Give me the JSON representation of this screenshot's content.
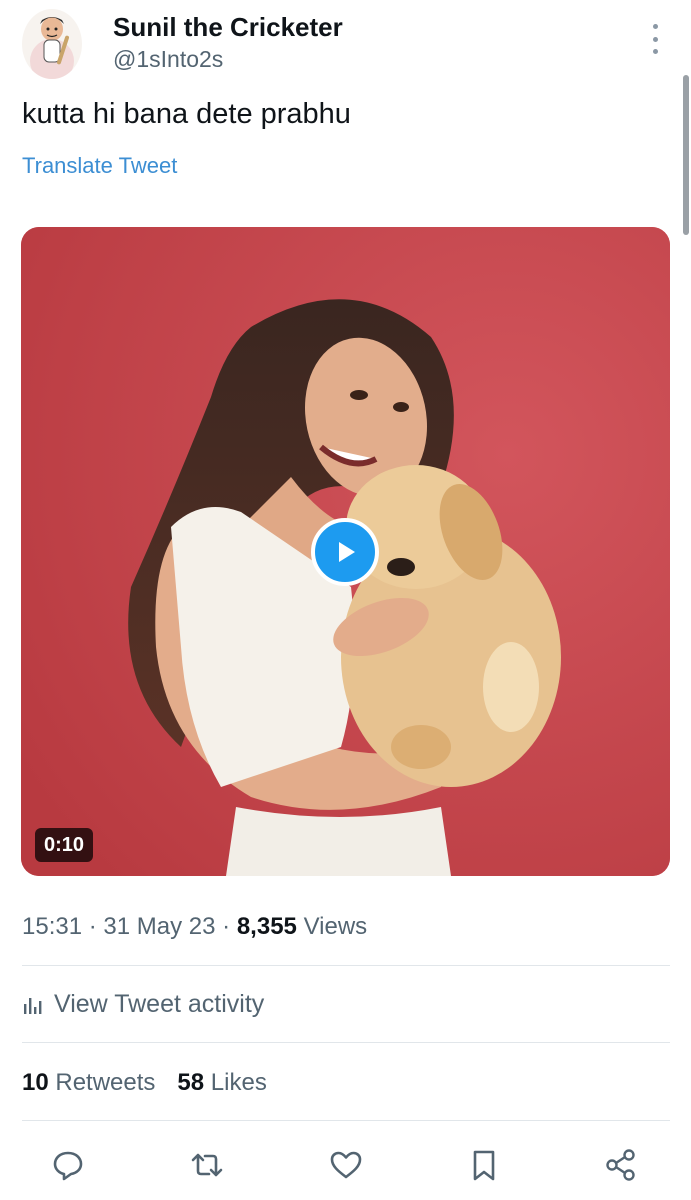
{
  "author": {
    "name": "Sunil the Cricketer",
    "handle": "@1sInto2s",
    "avatar_icon": "cricketer-caricature-avatar"
  },
  "tweet": {
    "text": "kutta hi bana dete prabhu",
    "translate_label": "Translate Tweet"
  },
  "media": {
    "type": "video",
    "duration": "0:10",
    "play_icon": "play-icon",
    "description_colors": {
      "background": "#c9464c"
    }
  },
  "meta": {
    "time": "15:31",
    "separator": "·",
    "date": "31 May 23",
    "views_count": "8,355",
    "views_label": "Views"
  },
  "activity": {
    "icon": "bar-chart-icon",
    "label": "View Tweet activity"
  },
  "stats": {
    "retweets_count": "10",
    "retweets_label": "Retweets",
    "likes_count": "58",
    "likes_label": "Likes"
  },
  "actions": [
    "reply-icon",
    "retweet-icon",
    "like-icon",
    "bookmark-icon",
    "share-icon"
  ],
  "colors": {
    "accent": "#1d9bf0",
    "link": "#3c8ed3",
    "muted_text": "#536471",
    "primary_text": "#0f1419"
  }
}
